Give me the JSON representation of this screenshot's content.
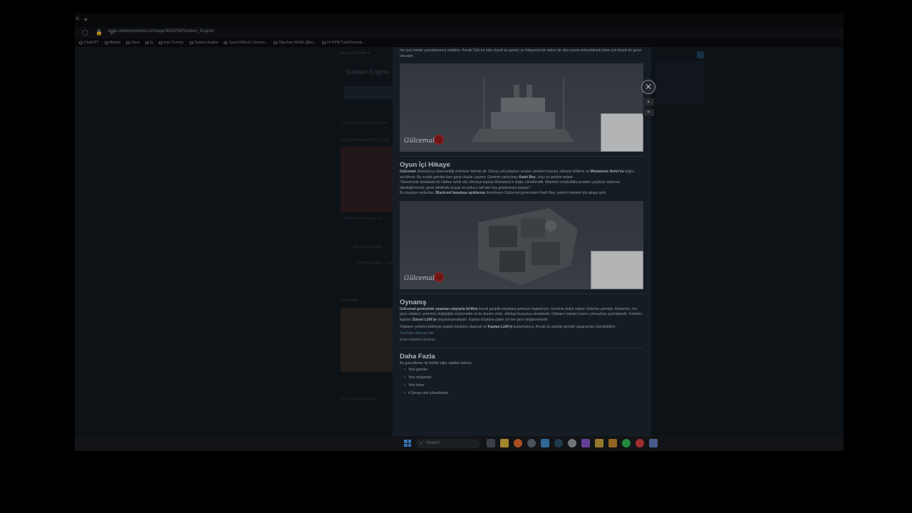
{
  "browser": {
    "new_tab": "+",
    "url": "store.steampowered.com/app/3634780/Sunken_Engine/",
    "bookmarks": [
      {
        "label": "ChatGPT"
      },
      {
        "label": "Bioklet"
      },
      {
        "label": "Oyun"
      },
      {
        "label": "İş"
      },
      {
        "label": "Icon Convoy"
      },
      {
        "label": "Sunken Engine"
      },
      {
        "label": "Sound Effects | Eleven..."
      },
      {
        "label": "Oğuzhan ARAR (@ko..."
      },
      {
        "label": "Fit RPM Türk/Osmanlı..."
      }
    ]
  },
  "background_page": {
    "nav": "Göz at  ▾     Öneriler  ▾",
    "title": "Sunken Engine",
    "review_text": "17 yıkılıdır incelemesi gösterir",
    "section1": "SON OYNANAN ALTIN YE SİL",
    "caption1": "Hikayemali, deterjan ve",
    "notify": "Her güncellemede ...",
    "curator": "Seçtiniz küratör ... tavsiyet yok",
    "section2": "ROADMAP",
    "section3": "BU OYUN HAKKINDA"
  },
  "modal": {
    "intro": "her şeyi birebir yansıtamamış olabiliriz. Ancak Türk bir ekip olarak bu gemiyi ve hikayesini bir nebze de olsa oyuna ekleyebilmek bizim için büyük bir gurur olacaktır.",
    "logo_text": "Gülcemal",
    "story": {
      "heading": "Oyun İçi Hikaye",
      "p1_bold1": "Gülcemal",
      "p1_a": ", Amerika'ya düzenlediği seferlerin birinde dir. Dönüş yolundayken anıdan sinlerleri bozulur, dümeni kilitlenir ve ",
      "p1_bold2": "Miskatonic Nehri'ne",
      "p1_b": " doğru sürüklenir. Bu sırada gemide bazı garip olaylar yaşanır. Geminin çarkçıbaşı ",
      "p1_bold3": "Kadri Bey",
      "p1_c": ", olayı şu şekilde anlatır:",
      "quote": "\"Gemimizde fevkalade bir hâdise zuhûr etti. Akıntıya kapılıp Miskatonic'e doğru sürüklendik. Motorları müşkülâtla yeniden çalıştırıp rotamıza döndüğümüzde, gemi dâhilinde acayip ve izahsız vak'alar baş göstermeye başladı.\"",
      "p2_a": "Bu olayların ardından, ",
      "p2_bold": "Blackreef kasabası açıklarına",
      "p2_b": " demirleyen Gülcemal gemisinden Kadri Bey, yardım istemek için adaya gelir."
    },
    "gameplay": {
      "heading": "Oynanış",
      "p1_bold1": "Gülcemal gemisinde yaşanan olaylarla birlikte",
      "p1_a": " birçok gariplik meydana gelmeye başlamıştır. Geminin bütün odaları birbirine girmiştir. Müşteriler, her gece odaların yerlerinin değiştiğini söylemekte ve bu durum onları oldukça huzursuz etmektedir. Odaların kapıları bazen çıkmazlara açılmaktadır. Geminin kaptanı ",
      "p1_bold2": "Süvari Lütfi'ye",
      "p1_b": " ulaşılamamaktadır. Kaptan köşküne giden yol her gece değişmektedir.",
      "p2_a": "Odaların yerlerini belirleyip kaptan köşküne ulaşmalı ve ",
      "p2_bold": "Kaptan Lütfi'yi",
      "p2_b": " kurtarmalıyız. Ancak bu şekilde gemide yaşananları düzeltebiliriz.",
      "video_link": "YouTube Videosu İzle",
      "early_access": "Erken Aşama Oynanış"
    },
    "more": {
      "heading": "Daha Fazla",
      "intro": "Bu güncelleme ile birlikte eğer vakitler kalırsa;",
      "items": [
        "Yeni gemiler",
        "Yeni müşteriler",
        "Yeni türler",
        "4.Seviye alet yükseltmesi"
      ]
    },
    "close_symbol": "✕",
    "up_symbol": "▲",
    "down_symbol": "▼"
  },
  "taskbar": {
    "search_placeholder": "Search"
  },
  "colors": {
    "accent_blue": "#3f8fd8",
    "seal_red": "#8a1c1c",
    "link": "#5f8fb3"
  }
}
